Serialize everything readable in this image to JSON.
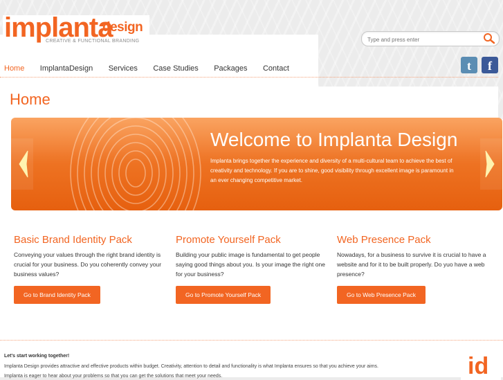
{
  "brand": {
    "logo_main": "implanta",
    "logo_sub": "design",
    "tagline": "CREATIVE & FUNCTIONAL BRANDING",
    "accent_color": "#f26522"
  },
  "search": {
    "placeholder": "Type and press enter",
    "icon": "search-icon"
  },
  "nav": {
    "items": [
      {
        "label": "Home",
        "active": true
      },
      {
        "label": "ImplantaDesign",
        "active": false
      },
      {
        "label": "Services",
        "active": false
      },
      {
        "label": "Case Studies",
        "active": false
      },
      {
        "label": "Packages",
        "active": false
      },
      {
        "label": "Contact",
        "active": false
      }
    ]
  },
  "social": {
    "twitter": {
      "glyph": "t",
      "icon": "twitter-icon",
      "color": "#5b8db3"
    },
    "facebook": {
      "glyph": "f",
      "icon": "facebook-icon",
      "color": "#3b5998"
    }
  },
  "page_title": "Home",
  "banner": {
    "title": "Welcome to Implanta Design",
    "text": "Implanta brings together the experience and diversity of a multi-cultural team to achieve the best of creativity and technology. If you are to shine, good visibility through excellent image is paramount in an ever changing competitive market."
  },
  "packs": [
    {
      "title": "Basic Brand Identity Pack",
      "text": "Conveying your values through the right brand identity is crucial for your business. Do you coherently convey your business values?",
      "button": "Go to Brand Identity Pack"
    },
    {
      "title": "Promote Yourself Pack",
      "text": "Building your public image is fundamental to get people saying good things about you. Is your image the right one for your business?",
      "button": "Go to Promote Yourself Pack"
    },
    {
      "title": "Web Presence Pack",
      "text": "Nowadays, for a business to survive it is crucial to have a website and for it to be built properly. Do yuo have a web presence?",
      "button": "Go to Web Presence Pack"
    }
  ],
  "footer": {
    "heading": "Let's start working together!",
    "line1": "Implanta Design provides attractive and effective products within budget. Creativity, attention to detail and functionality is what Implanta ensures so that you achieve your aims.",
    "line2": "Implanta is eager to hear about your problems so that you can get the solutions that meet your needs.",
    "badge": "id"
  }
}
